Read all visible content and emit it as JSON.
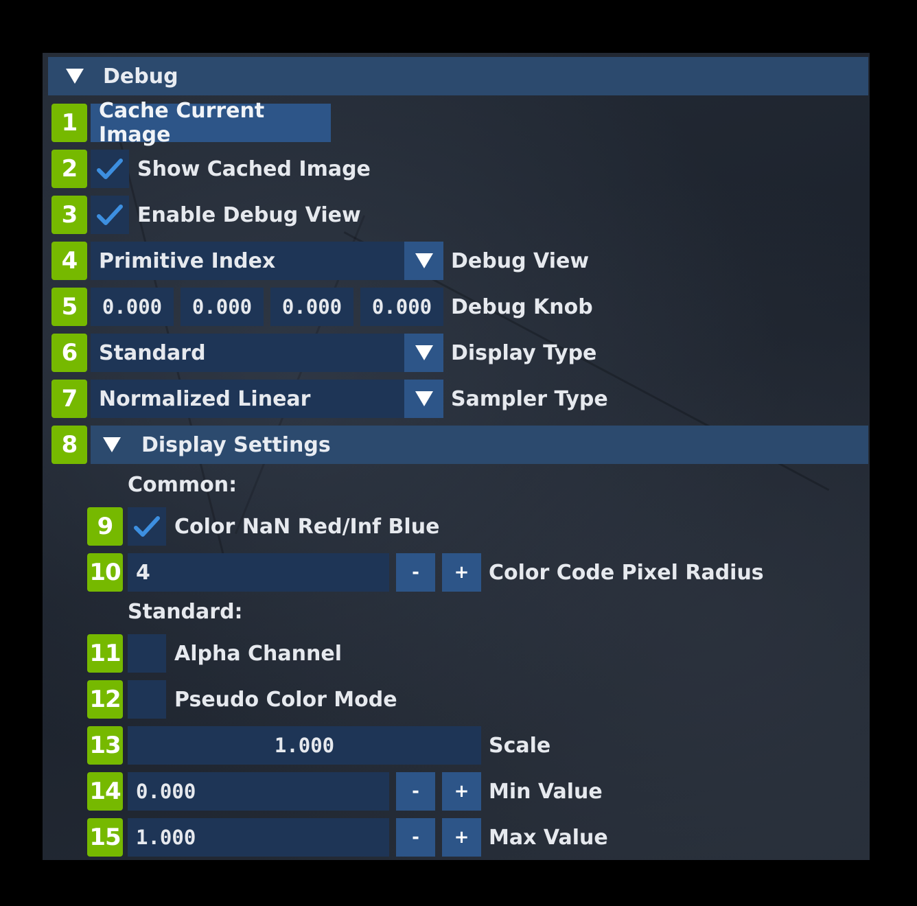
{
  "debug_header": {
    "title": "Debug",
    "icon": "collapse-triangle-icon"
  },
  "badges": [
    "1",
    "2",
    "3",
    "4",
    "5",
    "6",
    "7",
    "8",
    "9",
    "10",
    "11",
    "12",
    "13",
    "14",
    "15"
  ],
  "cache_button": {
    "label": "Cache Current Image"
  },
  "show_cached": {
    "label": "Show Cached Image",
    "checked": true
  },
  "enable_debug": {
    "label": "Enable Debug View",
    "checked": true
  },
  "debug_view": {
    "value": "Primitive Index",
    "label": "Debug View"
  },
  "debug_knob": {
    "values": [
      "0.000",
      "0.000",
      "0.000",
      "0.000"
    ],
    "label": "Debug Knob"
  },
  "display_type": {
    "value": "Standard",
    "label": "Display Type"
  },
  "sampler_type": {
    "value": "Normalized Linear",
    "label": "Sampler Type"
  },
  "display_settings": {
    "title": "Display Settings",
    "common_label": "Common:",
    "color_nan": {
      "label": "Color NaN Red/Inf Blue",
      "checked": true
    },
    "pixel_radius": {
      "value": "4",
      "minus": "-",
      "plus": "+",
      "label": "Color Code Pixel Radius"
    },
    "standard_label": "Standard:",
    "alpha_channel": {
      "label": "Alpha Channel",
      "checked": false
    },
    "pseudo_color": {
      "label": "Pseudo Color Mode",
      "checked": false
    },
    "scale": {
      "value": "1.000",
      "label": "Scale"
    },
    "min_value": {
      "value": "0.000",
      "minus": "-",
      "plus": "+",
      "label": "Min Value"
    },
    "max_value": {
      "value": "1.000",
      "minus": "-",
      "plus": "+",
      "label": "Max Value"
    }
  },
  "colors": {
    "accent_badge": "#76b900",
    "header_bg": "#2c4a6e",
    "button_bg": "#2d5588",
    "field_bg": "#1e3556",
    "check": "#3d8fe0"
  }
}
